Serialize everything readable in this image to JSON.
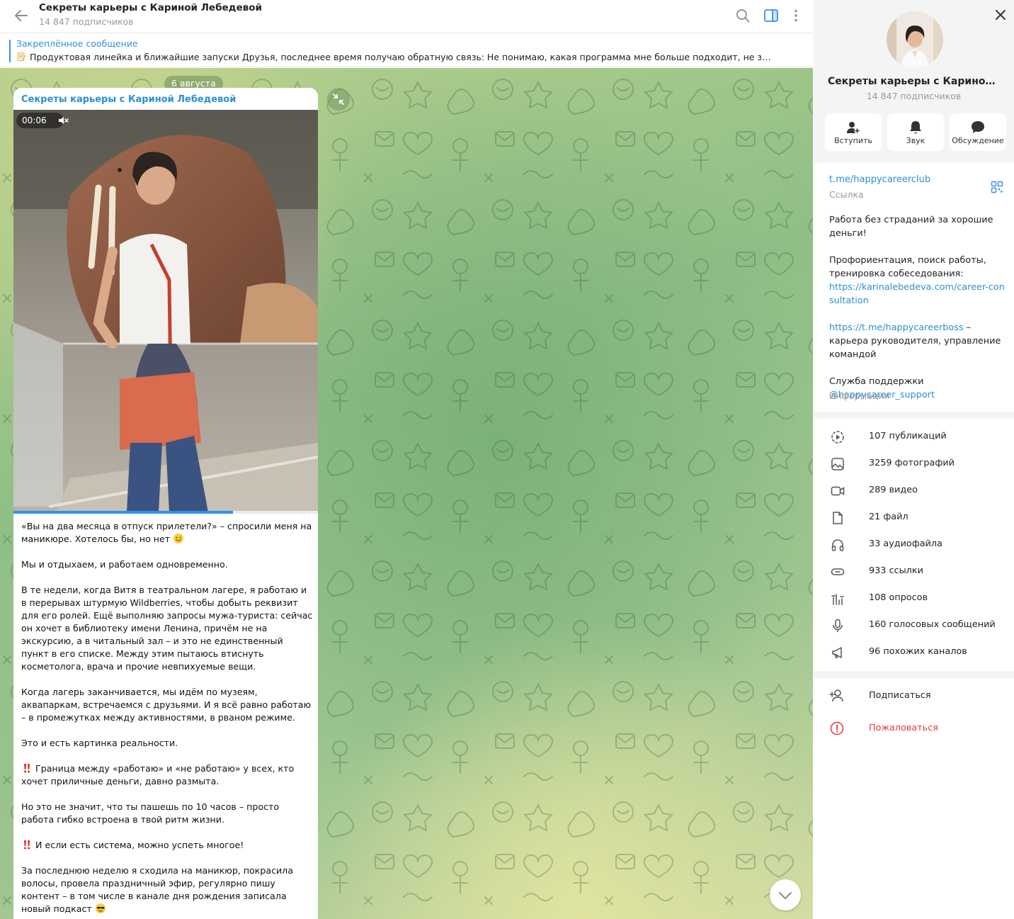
{
  "header": {
    "title": "Секреты карьеры с Кариной Лебедевой",
    "subtitle": "14 847 подписчиков"
  },
  "pinned": {
    "title": "Закреплённое сообщение",
    "text": "Продуктовая линейка и ближайшие запуски  Друзья, последнее время получаю обратную связь: Не понимаю, какая программа мне больше подходит, не знаю, что..."
  },
  "chat": {
    "date": "6 августа",
    "post": {
      "author": "Секреты карьеры с Кариной Лебедевой",
      "video_time": "00:06",
      "video_progress": 0.72,
      "paragraphs": [
        "«Вы на два месяца в отпуск прилетели?» – спросили меня на маникюре. Хотелось бы, но нет",
        "Мы и отдыхаем, и работаем одновременно.",
        "В те недели, когда Витя в театральном лагере, я работаю и в перерывах штурмую Wildberries, чтобы добыть реквизит для его ролей. Ещё выполняю запросы мужа-туриста: сейчас он хочет в библиотеку имени Ленина, причём не на экскурсию, а в читальный зал – и это не единственный пункт в его списке. Между этим пытаюсь втиснуть косметолога, врача и прочие невпихуемые вещи.",
        "Когда лагерь заканчивается, мы идём по музеям, аквапаркам, встречаемся с друзьями. И я всё равно работаю – в промежутках между активностями, в рваном режиме.",
        "Это и есть картинка реальности.",
        "Граница между «работаю» и «не работаю» у всех, кто хочет приличные деньги, давно размыта.",
        "Но это не значит, что ты пашешь по 10 часов – просто работа гибко встроена в твой ритм жизни.",
        "И если есть система, можно успеть многое!",
        "За последнюю неделю я сходила на маникюр, покрасила волосы, провела праздничный эфир, регулярно пишу контент – в том числе в канале дня рождения записала новый подкаст"
      ]
    }
  },
  "profile": {
    "name": "Секреты карьеры с Кариной Ле...",
    "subscribers": "14 847 подписчиков",
    "buttons": [
      {
        "label": "Вступить",
        "icon": "add-user-icon"
      },
      {
        "label": "Звук",
        "icon": "bell-icon"
      },
      {
        "label": "Обсуждение",
        "icon": "chat-icon"
      }
    ],
    "link": "t.me/happycareerclub",
    "link_label": "Ссылка",
    "description": {
      "line1": "Работа без страданий за хорошие деньги!",
      "line2": "Профориентация, поиск работы, тренировка собеседования:",
      "link1": "https://karinalebedeva.com/career-consultation",
      "link2": "https://t.me/happycareerboss",
      "link2_tail": " –карьера руководителя, управление командой",
      "support": "Служба поддержки",
      "support_link": "@happycareer_support"
    },
    "info_label": "Информация",
    "media": [
      {
        "label": "107 публикаций",
        "icon": "stories-icon"
      },
      {
        "label": "3259 фотографий",
        "icon": "photo-icon"
      },
      {
        "label": "289 видео",
        "icon": "video-icon"
      },
      {
        "label": "21 файл",
        "icon": "file-icon"
      },
      {
        "label": "33 аудиофайла",
        "icon": "headphones-icon"
      },
      {
        "label": "933 ссылки",
        "icon": "link-icon"
      },
      {
        "label": "108 опросов",
        "icon": "poll-icon"
      },
      {
        "label": "160 голосовых сообщений",
        "icon": "microphone-icon"
      },
      {
        "label": "96 похожих каналов",
        "icon": "megaphone-icon"
      }
    ],
    "actions": [
      {
        "label": "Подписаться",
        "icon": "add-user-icon",
        "color": "#222222"
      },
      {
        "label": "Пожаловаться",
        "icon": "warning-icon",
        "color": "#e53935"
      }
    ]
  },
  "colors": {
    "accent": "#3390ec",
    "link": "#2b8fd6",
    "danger": "#e53935"
  }
}
